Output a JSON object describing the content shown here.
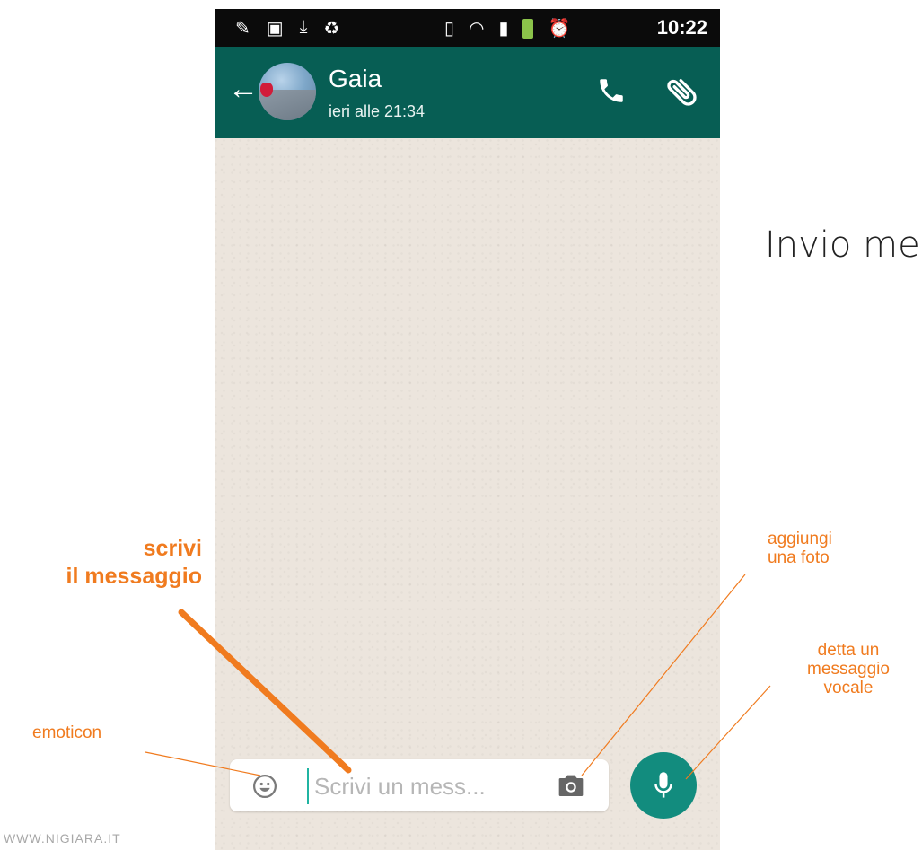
{
  "status_bar": {
    "time": "10:22"
  },
  "header": {
    "contact_name": "Gaia",
    "last_seen": "ieri alle 21:34"
  },
  "composer": {
    "placeholder": "Scrivi un mess..."
  },
  "title": "Invio me",
  "annotations": {
    "write_message": [
      "scrivi",
      "il messaggio"
    ],
    "emoticon": "emoticon",
    "add_photo": [
      "aggiungi",
      "una foto"
    ],
    "voice_message": [
      "detta un",
      "messaggio",
      "vocale"
    ]
  },
  "watermark": "WWW.NIGIARA.IT",
  "colors": {
    "header": "#075e54",
    "accent": "#128c7e",
    "annotation": "#f07b1f",
    "chat_bg": "#ece5dd"
  },
  "icons": [
    "back-arrow-icon",
    "avatar",
    "phone-icon",
    "paperclip-icon",
    "emoji-icon",
    "camera-icon",
    "microphone-icon"
  ]
}
